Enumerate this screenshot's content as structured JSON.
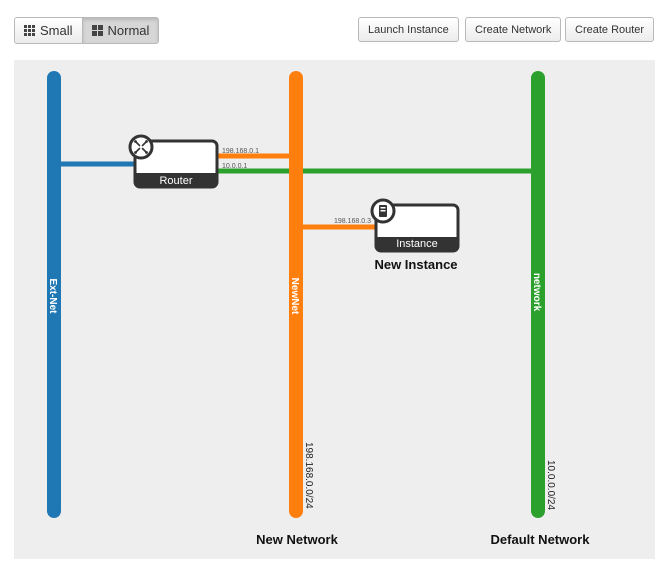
{
  "toolbar": {
    "view_small_label": "Small",
    "view_normal_label": "Normal",
    "launch_instance_label": "Launch Instance",
    "create_network_label": "Create Network",
    "create_router_label": "Create Router"
  },
  "colors": {
    "ext_net": "#1f77b4",
    "new_net": "#ff7f0e",
    "network": "#2ca02c",
    "node_dark": "#333333"
  },
  "networks": {
    "ext_net": {
      "name": "Ext-Net"
    },
    "new_net": {
      "name": "NewNet",
      "cidr": "198.168.0.0/24",
      "caption": "New Network"
    },
    "network": {
      "name": "network",
      "cidr": "10.0.0.0/24",
      "caption": "Default Network"
    }
  },
  "router": {
    "label": "Router",
    "icon": "router-icon",
    "ip_new_net": "198.168.0.1",
    "ip_network": "10.0.0.1"
  },
  "instance": {
    "label": "Instance",
    "icon": "server-icon",
    "caption": "New Instance",
    "ip": "198.168.0.3"
  }
}
